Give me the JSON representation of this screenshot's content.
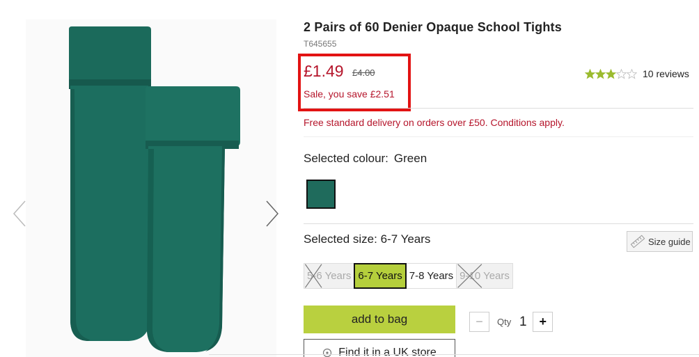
{
  "product": {
    "title": "2 Pairs of 60 Denier Opaque School Tights",
    "sku": "T645655",
    "image_icon": "tights-image"
  },
  "price": {
    "now": "£1.49",
    "was": "£4.00",
    "saving": "Sale, you save £2.51",
    "highlight_color": "#e21313",
    "price_color": "#b5152b"
  },
  "rating": {
    "stars_filled": 3,
    "stars_total": 5,
    "reviews_label": "10 reviews",
    "star_color": "#9bbb2f"
  },
  "delivery": {
    "text": "Free standard delivery on orders over £50. Conditions apply."
  },
  "colour": {
    "label": "Selected colour:",
    "value": "Green",
    "swatch_color": "#1f6b5c"
  },
  "size": {
    "label": "Selected size:",
    "value": "6-7 Years",
    "guide_label": "Size guide",
    "options": [
      {
        "label": "5-6 Years",
        "available": false,
        "selected": false
      },
      {
        "label": "6-7 Years",
        "available": true,
        "selected": true
      },
      {
        "label": "7-8 Years",
        "available": true,
        "selected": false
      },
      {
        "label": "9-10 Years",
        "available": false,
        "selected": false
      }
    ]
  },
  "purchase": {
    "add_label": "add to bag",
    "add_color": "#b9d03f",
    "qty_label": "Qty",
    "qty_value": "1",
    "minus": "−",
    "plus": "+",
    "find_store_label": "Find it in a UK store"
  },
  "gallery": {
    "prev_icon": "chevron-left-icon",
    "next_icon": "chevron-right-icon"
  }
}
